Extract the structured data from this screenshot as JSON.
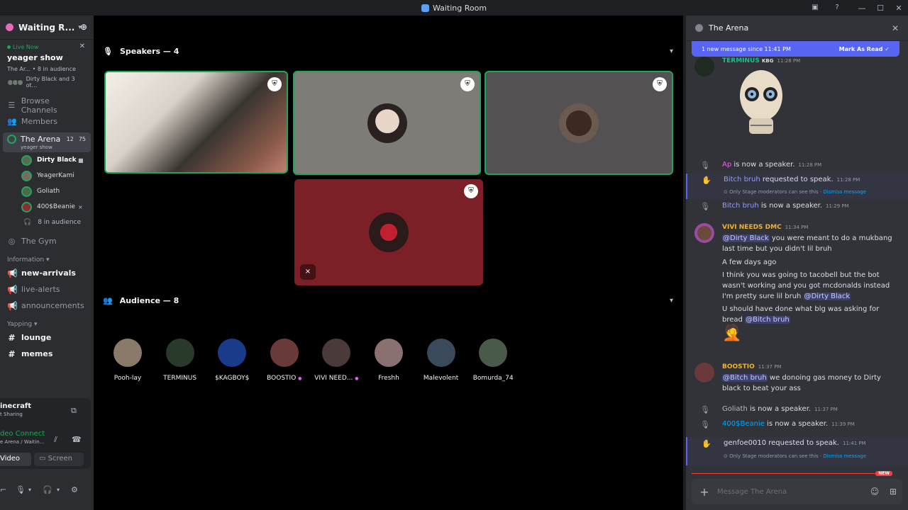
{
  "window": {
    "title": "Waiting Room",
    "controls": [
      "—",
      "☐",
      "✕"
    ]
  },
  "sidebar": {
    "server_name": "Waiting R...",
    "live": {
      "badge": "Live Now",
      "title": "yeager show",
      "channel": "The Ar...",
      "audience": "8 in audience",
      "speakers": "Dirty Black and 3 ot..."
    },
    "nav": [
      {
        "label": "Browse Channels",
        "icon": "☰"
      },
      {
        "label": "Members",
        "icon": "👥"
      }
    ],
    "arena": {
      "label": "The Arena",
      "count1": "12",
      "count2": "75",
      "topic": "yeager show"
    },
    "members": [
      {
        "name": "Dirty Black",
        "color": "#5b6b53"
      },
      {
        "name": "YeagerKami",
        "color": "#7a6b62"
      },
      {
        "name": "Goliath",
        "color": "#4a6a4a"
      },
      {
        "name": "400$Beanie",
        "color": "#8b2d33"
      }
    ],
    "audience_label": "8 in audience",
    "gym": "The Gym",
    "categories": [
      {
        "label": "Information",
        "channels": [
          {
            "name": "new-arrivals",
            "icon": "📢",
            "unread": true
          },
          {
            "name": "live-alerts",
            "icon": "📢",
            "unread": false
          },
          {
            "name": "announcements",
            "icon": "📢",
            "unread": false
          }
        ]
      },
      {
        "label": "Yapping",
        "channels": [
          {
            "name": "lounge",
            "icon": "#",
            "unread": true
          },
          {
            "name": "memes",
            "icon": "#",
            "unread": true
          }
        ]
      }
    ],
    "stream": {
      "title": "inecraft",
      "sub": "t Sharing"
    },
    "voice": {
      "status": "deo Connect",
      "sub": "e Arena / Waitin..."
    },
    "video_label": "Video",
    "screen_label": "Screen"
  },
  "stage": {
    "speakers_header": "Speakers — 4",
    "audience_header": "Audience — 8",
    "audience": [
      {
        "name": "Pooh-lay",
        "color": "#8a7a6a",
        "boost": false
      },
      {
        "name": "TERMINUS",
        "color": "#2a3a2a",
        "boost": false
      },
      {
        "name": "$KAGBOY$",
        "color": "#1a3a8a",
        "boost": false
      },
      {
        "name": "BOOSTIO",
        "color": "#6a3a3a",
        "boost": true
      },
      {
        "name": "VIVI NEED...",
        "color": "#4a3a3a",
        "boost": true
      },
      {
        "name": "Freshh",
        "color": "#8a7070",
        "boost": false
      },
      {
        "name": "Malevolent",
        "color": "#3a4a5a",
        "boost": false
      },
      {
        "name": "Bomurda_74",
        "color": "#4a5a4a",
        "boost": false
      }
    ]
  },
  "chat": {
    "title": "The Arena",
    "new_bar": "1 new message since 11:41 PM",
    "mark_read": "Mark As Read",
    "terminus": {
      "author": "TERMINUS",
      "tag": "KBG",
      "time": "11:28 PM",
      "color": "#1abc9c"
    },
    "events": [
      {
        "name": "Ap",
        "text": "is now a speaker.",
        "time": "11:28 PM",
        "color": "#e466e8"
      },
      {
        "name": "Bitch bruh",
        "text": "requested to speak.",
        "time": "11:28 PM",
        "color": "#949cf7",
        "note": "Only Stage moderators can see this · ",
        "dismiss": "Dismiss message"
      },
      {
        "name": "Bitch bruh",
        "text": "is now a speaker.",
        "time": "11:29 PM",
        "color": "#949cf7"
      }
    ],
    "vivi": {
      "author": "VIVI NEEDS DMC",
      "time": "11:34 PM",
      "color": "#f0b232",
      "m1_mention": "@Dirty Black",
      "m1": "you were meant to do a mukbang last time but you didn't lil bruh",
      "m2": "A few days ago",
      "m3": "I think you was going to tacobell but the bot wasn't working and you got mcdonalds instead I'm pretty sure lil bruh",
      "m3_mention": "@Dirty Black",
      "m4": "U should have done what blg was asking for bread",
      "m4_mention": "@Bitch bruh",
      "emoji": "🤦"
    },
    "boostio": {
      "author": "BOOSTIO",
      "time": "11:37 PM",
      "color": "#f0b232",
      "mention": "@Bitch bruh",
      "text": "we donoing gas money to Dirty black to beat your ass"
    },
    "events2": [
      {
        "name": "Goliath",
        "text": "is now a speaker.",
        "time": "11:37 PM",
        "color": "#b5bac1"
      },
      {
        "name": "400$Beanie",
        "text": "is now a speaker.",
        "time": "11:39 PM",
        "color": "#00a8fc"
      }
    ],
    "new_tag": "NEW",
    "last": {
      "name": "genfoe0010",
      "text": "requested to speak.",
      "time": "11:41 PM",
      "note": "Only Stage moderators can see this · ",
      "dismiss": "Dismiss message"
    },
    "composer_placeholder": "Message The Arena"
  }
}
